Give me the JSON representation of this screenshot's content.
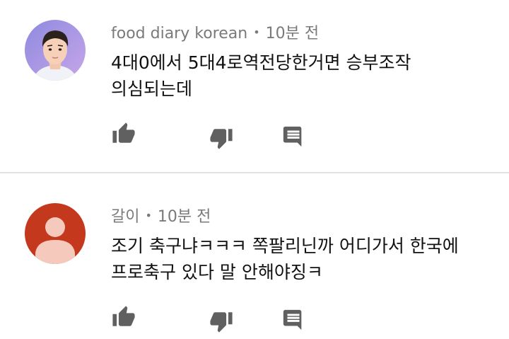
{
  "comments": [
    {
      "author": "food diary korean",
      "separator": "•",
      "time": "10분 전",
      "lines": [
        "4대0에서 5대4로역전당한거면 승부조작",
        "의심되는데"
      ],
      "avatar": "photo-avatar"
    },
    {
      "author": "갈이",
      "separator": "•",
      "time": "10분 전",
      "lines": [
        "조기 축구냐ㅋㅋㅋ 쪽팔리닌까 어디가서 한국에",
        "프로축구 있다 말 안해야징ㅋ"
      ],
      "avatar": "default-avatar"
    }
  ],
  "icons": {
    "like": "thumbs-up-icon",
    "dislike": "thumbs-down-icon",
    "reply": "reply-icon"
  },
  "colors": {
    "icon": "#606060",
    "default_avatar_bg": "#c4391d",
    "default_avatar_fg": "#f6c9bd",
    "meta_text": "#7a7a7a"
  }
}
